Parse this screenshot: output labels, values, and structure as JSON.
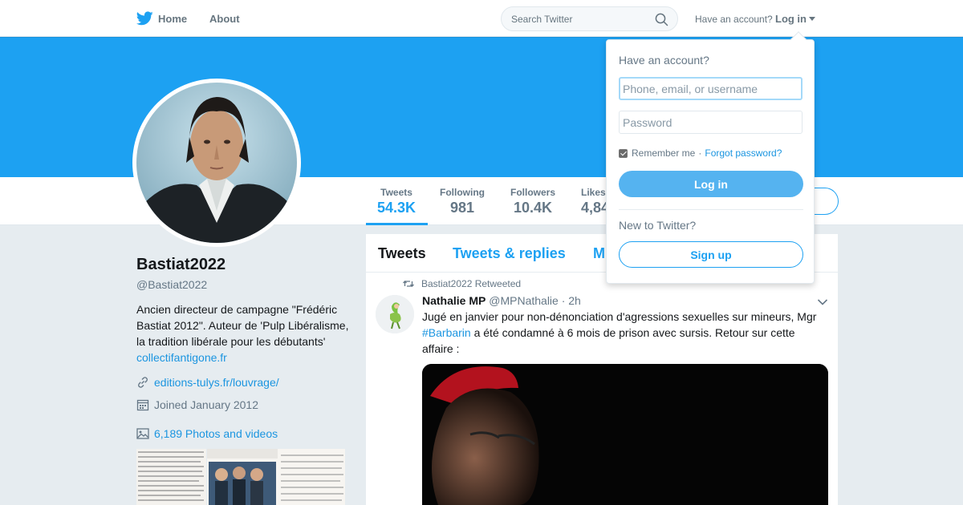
{
  "topbar": {
    "home_label": "Home",
    "about_label": "About",
    "search_placeholder": "Search Twitter",
    "have_account": "Have an account?",
    "login_label": "Log in"
  },
  "profile": {
    "name": "Bastiat2022",
    "handle": "@Bastiat2022",
    "bio_text": "Ancien directeur de campagne \"Frédéric Bastiat 2012\". Auteur de 'Pulp Libéralisme, la tradition libérale pour les débutants'",
    "bio_link": "collectifantigone.fr",
    "website": "editions-tulys.fr/louvrage/",
    "joined": "Joined January 2012",
    "photos_videos": "6,189 Photos and videos"
  },
  "stats": [
    {
      "label": "Tweets",
      "value": "54.3K"
    },
    {
      "label": "Following",
      "value": "981"
    },
    {
      "label": "Followers",
      "value": "10.4K"
    },
    {
      "label": "Likes",
      "value": "4,84"
    }
  ],
  "timeline": {
    "tabs": [
      "Tweets",
      "Tweets & replies",
      "M"
    ],
    "tweet": {
      "retweeted_by": "Bastiat2022 Retweeted",
      "author": "Nathalie MP",
      "author_handle": "@MPNathalie",
      "time": "· 2h",
      "text_before": "Jugé en janvier pour non-dénonciation d'agressions sexuelles sur mineurs, Mgr ",
      "hashtag": "#Barbarin",
      "text_after": " a été condamné à 6 mois de prison avec sursis. Retour sur cette affaire :"
    }
  },
  "login_dropdown": {
    "title": "Have an account?",
    "username_placeholder": "Phone, email, or username",
    "password_placeholder": "Password",
    "remember_me": "Remember me",
    "separator": "·",
    "forgot_password": "Forgot password?",
    "login_button": "Log in",
    "new_to_twitter": "New to Twitter?",
    "signup_button": "Sign up"
  },
  "colors": {
    "accent": "#1da1f2",
    "banner": "#1da1f2",
    "link": "#1b95e0",
    "background": "#e6ecf0"
  },
  "icons": [
    "twitter-bird-icon",
    "search-icon",
    "caret-down-icon",
    "link-icon",
    "calendar-icon",
    "photo-icon",
    "retweet-icon",
    "chevron-down-icon"
  ]
}
